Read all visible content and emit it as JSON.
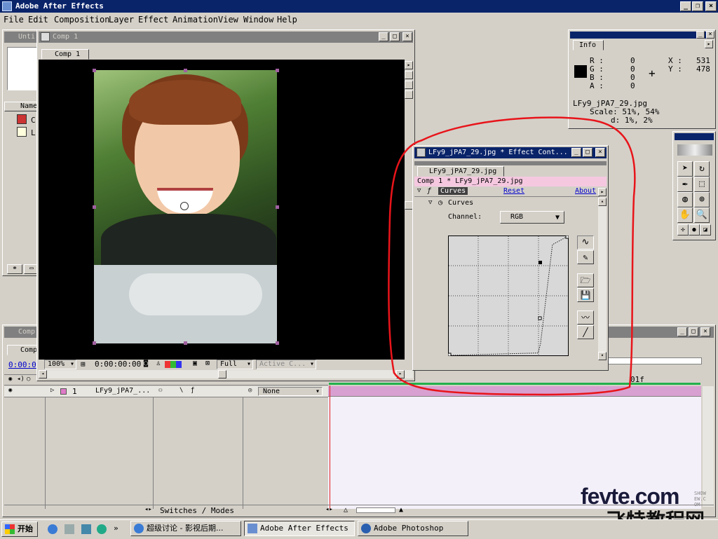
{
  "app": {
    "title": "Adobe After Effects"
  },
  "menu": [
    "File",
    "Edit",
    "Composition",
    "Layer",
    "Effect",
    "Animation",
    "View",
    "Window",
    "Help"
  ],
  "project": {
    "title": "Unti",
    "col_name": "Name",
    "items": [
      "C",
      "L"
    ]
  },
  "comp": {
    "title": "Comp 1",
    "tab": "Comp 1",
    "zoom": "100%",
    "timecode": "0:00:00:00",
    "resolution": "Full",
    "camera": "Active C..."
  },
  "info": {
    "tab": "Info",
    "r_label": "R :",
    "r": "0",
    "g_label": "G :",
    "g": "0",
    "b_label": "B :",
    "b": "0",
    "a_label": "A :",
    "a": "0",
    "x_label": "X :",
    "x": "531",
    "y_label": "Y :",
    "y": "478",
    "file": "LFy9_jPA7_29.jpg",
    "scale": "Scale: 51%, 54%",
    "offset": "d: 1%, 2%"
  },
  "effect": {
    "title": "LFy9_jPA7_29.jpg * Effect Cont...",
    "tab": "LFy9_jPA7_29.jpg",
    "breadcrumb": "Comp 1 * LFy9_jPA7_29.jpg",
    "effect_name": "Curves",
    "reset": "Reset",
    "about": "About",
    "prop_name": "Curves",
    "channel_label": "Channel:",
    "channel_value": "RGB",
    "curve_points": [
      [
        0,
        0
      ],
      [
        0.75,
        0.02
      ],
      [
        0.77,
        0.1
      ],
      [
        0.87,
        0.93
      ],
      [
        1,
        1
      ]
    ]
  },
  "timeline": {
    "title": "Comp",
    "tab": "Comp",
    "timecode": "0:00:0",
    "ruler_end": "01f",
    "layer_num": "1",
    "layer_name": "LFy9_jPA7_...",
    "mode": "None",
    "switches_label": "Switches / Modes"
  },
  "taskbar": {
    "start": "开始",
    "items": [
      "超级讨论 - 影视后期...",
      "Adobe After Effects",
      "Adobe Photoshop"
    ]
  },
  "watermark": {
    "line1": "fevte.com",
    "line2": "飞特教程网",
    "side": "SHOWEW.COM"
  },
  "colors": {
    "title_active": "#0a246a",
    "annotation": "#e8141a",
    "layer_bar": "#d8a0d0",
    "timeline_bg": "#f4f0fa",
    "workarea": "#22b14c"
  }
}
